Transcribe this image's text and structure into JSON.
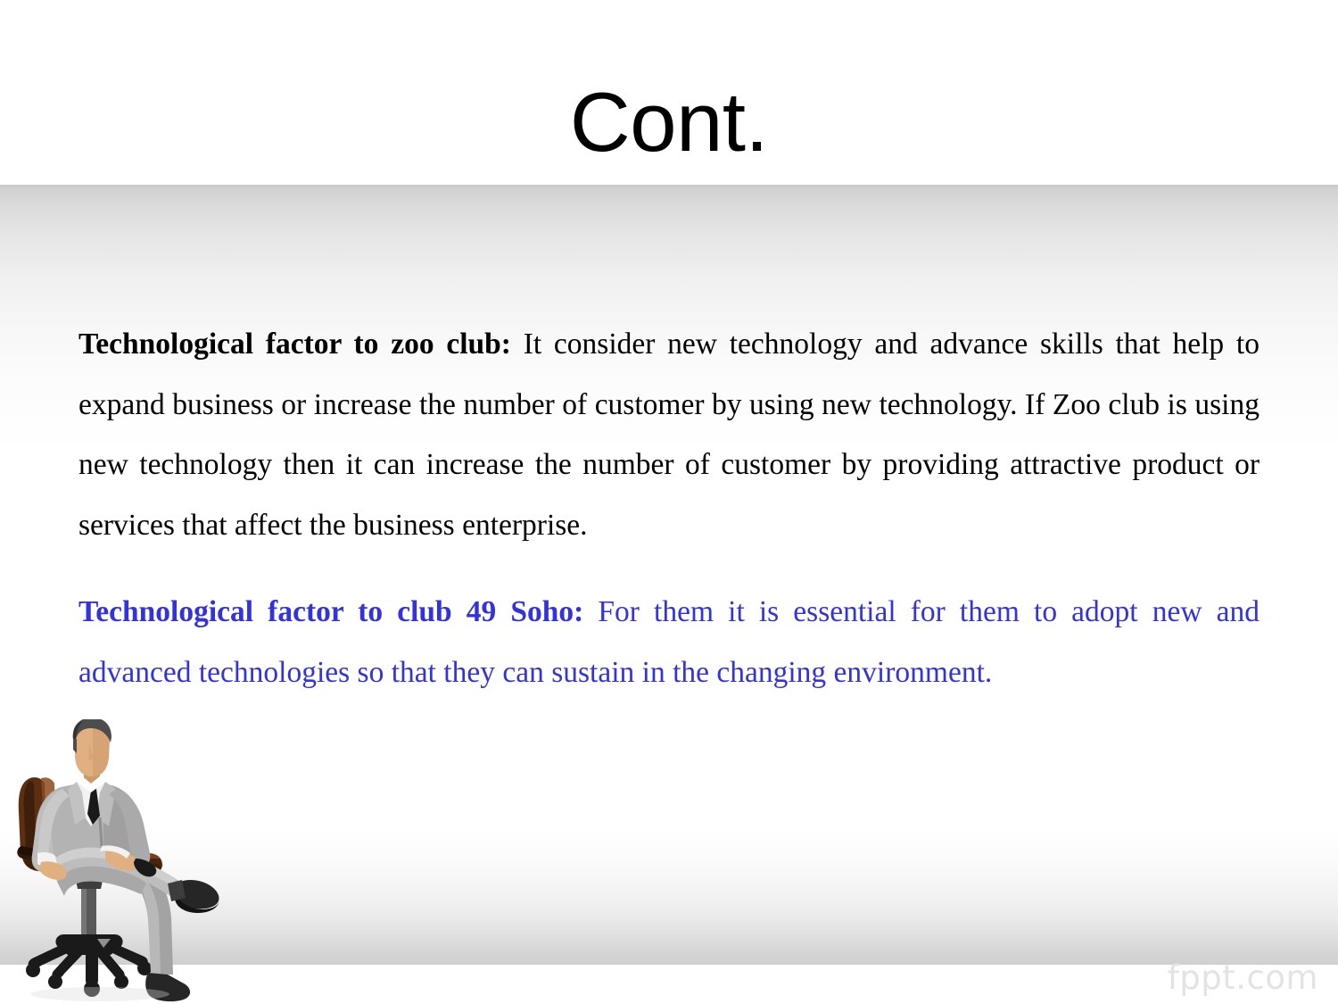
{
  "slide": {
    "title": "Cont.",
    "background": {
      "page_color": "#ffffff",
      "band_gray": "#cccccc"
    }
  },
  "body": {
    "paragraphs": [
      {
        "id": "zoo-club",
        "color": "#000000",
        "lead_in": "Technological factor to zoo club:",
        "text": " It consider new technology and advance skills that help to expand business or increase the number of customer by using new technology. If Zoo club is using new technology then it can increase the number of customer by providing attractive product or services that affect the business enterprise."
      },
      {
        "id": "club-49-soho",
        "color": "#3333dd",
        "lead_in": "Technological factor to club 49 Soho:",
        "text": " For them it is essential for them to adopt new and advanced technologies so that they can sustain in the changing environment."
      }
    ]
  },
  "watermark": {
    "text": "fppt.com",
    "color": "#e3e3e3"
  },
  "illustration": {
    "name": "businessman-sitting-on-office-chair",
    "alt": "Man in grey suit with black tie seated cross-legged on a brown office chair with black five-star base",
    "colors": {
      "suit": "#b3b3b3",
      "suit_shadow": "#8f8f8f",
      "suit_highlight": "#cccccc",
      "shirt": "#f2f2f2",
      "tie": "#1a1a1a",
      "skin": "#e0b080",
      "skin_shadow": "#c89a6a",
      "hair": "#4d4d4d",
      "chair": "#5c2f11",
      "chair_light": "#8a4a1f",
      "chair_dark": "#3d1f0a",
      "base": "#1a1a1a",
      "shoe": "#262626",
      "column": "#595959"
    }
  }
}
